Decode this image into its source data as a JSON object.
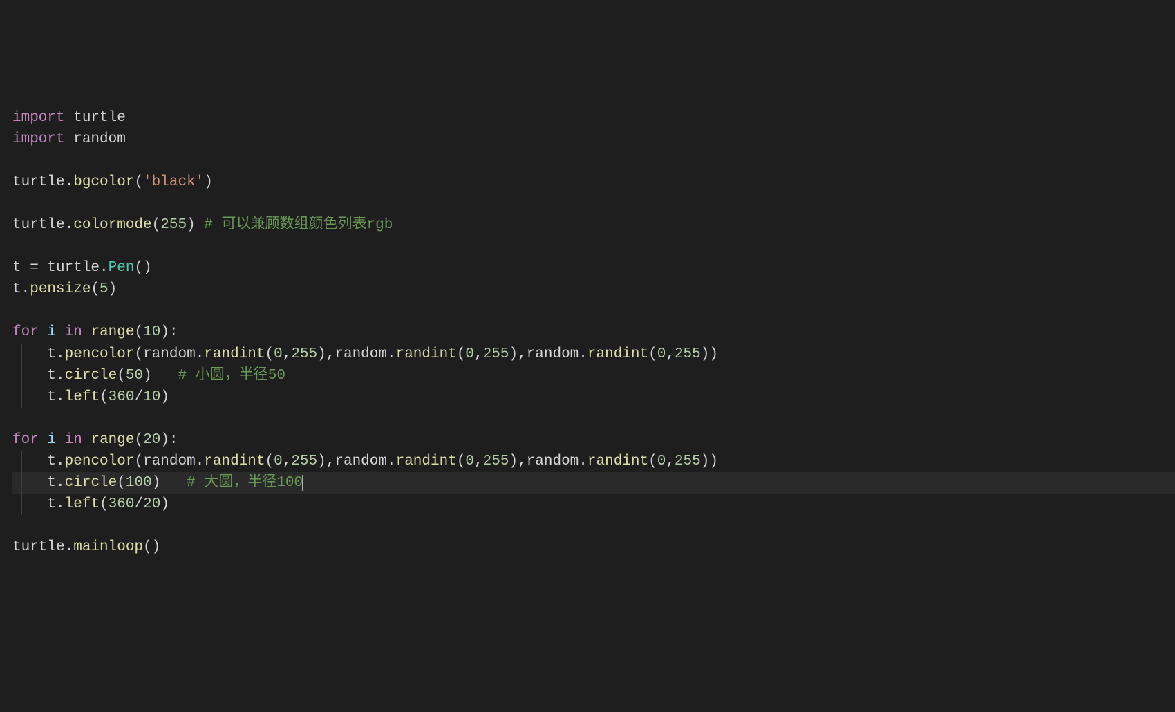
{
  "code": {
    "line1": {
      "import": "import",
      "module": " turtle"
    },
    "line2": {
      "import": "import",
      "module": " random"
    },
    "line4": {
      "obj": "turtle.",
      "method": "bgcolor",
      "open": "(",
      "str": "'black'",
      "close": ")"
    },
    "line6": {
      "obj": "turtle.",
      "method": "colormode",
      "open": "(",
      "num": "255",
      "close": ") ",
      "comment": "# 可以兼顾数组颜色列表rgb"
    },
    "line8": {
      "var": "t",
      "eq": " = ",
      "obj": "turtle.",
      "class": "Pen",
      "parens": "()"
    },
    "line9": {
      "obj": "t.",
      "method": "pensize",
      "open": "(",
      "num": "5",
      "close": ")"
    },
    "line11": {
      "for": "for",
      "sp1": " ",
      "var": "i",
      "sp2": " ",
      "in": "in",
      "sp3": " ",
      "range": "range",
      "open": "(",
      "num": "10",
      "close": "):"
    },
    "line12": {
      "indent": "    ",
      "obj": "t.",
      "method": "pencolor",
      "open": "(",
      "r1": "random.",
      "rint1": "randint",
      "p1": "(",
      "n1": "0",
      "c1": ",",
      "n2": "255",
      "p2": "),",
      "r2": "random.",
      "rint2": "randint",
      "p3": "(",
      "n3": "0",
      "c2": ",",
      "n4": "255",
      "p4": "),",
      "r3": "random.",
      "rint3": "randint",
      "p5": "(",
      "n5": "0",
      "c3": ",",
      "n6": "255",
      "p6": "))"
    },
    "line13": {
      "indent": "    ",
      "obj": "t.",
      "method": "circle",
      "open": "(",
      "num": "50",
      "close": ")   ",
      "comment": "# 小圆，半径50"
    },
    "line14": {
      "indent": "    ",
      "obj": "t.",
      "method": "left",
      "open": "(",
      "num1": "360",
      "op": "/",
      "num2": "10",
      "close": ")"
    },
    "line16": {
      "for": "for",
      "sp1": " ",
      "var": "i",
      "sp2": " ",
      "in": "in",
      "sp3": " ",
      "range": "range",
      "open": "(",
      "num": "20",
      "close": "):"
    },
    "line17": {
      "indent": "    ",
      "obj": "t.",
      "method": "pencolor",
      "open": "(",
      "r1": "random.",
      "rint1": "randint",
      "p1": "(",
      "n1": "0",
      "c1": ",",
      "n2": "255",
      "p2": "),",
      "r2": "random.",
      "rint2": "randint",
      "p3": "(",
      "n3": "0",
      "c2": ",",
      "n4": "255",
      "p4": "),",
      "r3": "random.",
      "rint3": "randint",
      "p5": "(",
      "n5": "0",
      "c3": ",",
      "n6": "255",
      "p6": "))"
    },
    "line18": {
      "indent": "    ",
      "obj": "t.",
      "method": "circle",
      "open": "(",
      "num": "100",
      "close": ")   ",
      "comment": "# 大圆，半径100"
    },
    "line19": {
      "indent": "    ",
      "obj": "t.",
      "method": "left",
      "open": "(",
      "num1": "360",
      "op": "/",
      "num2": "20",
      "close": ")"
    },
    "line21": {
      "obj": "turtle.",
      "method": "mainloop",
      "parens": "()"
    }
  }
}
